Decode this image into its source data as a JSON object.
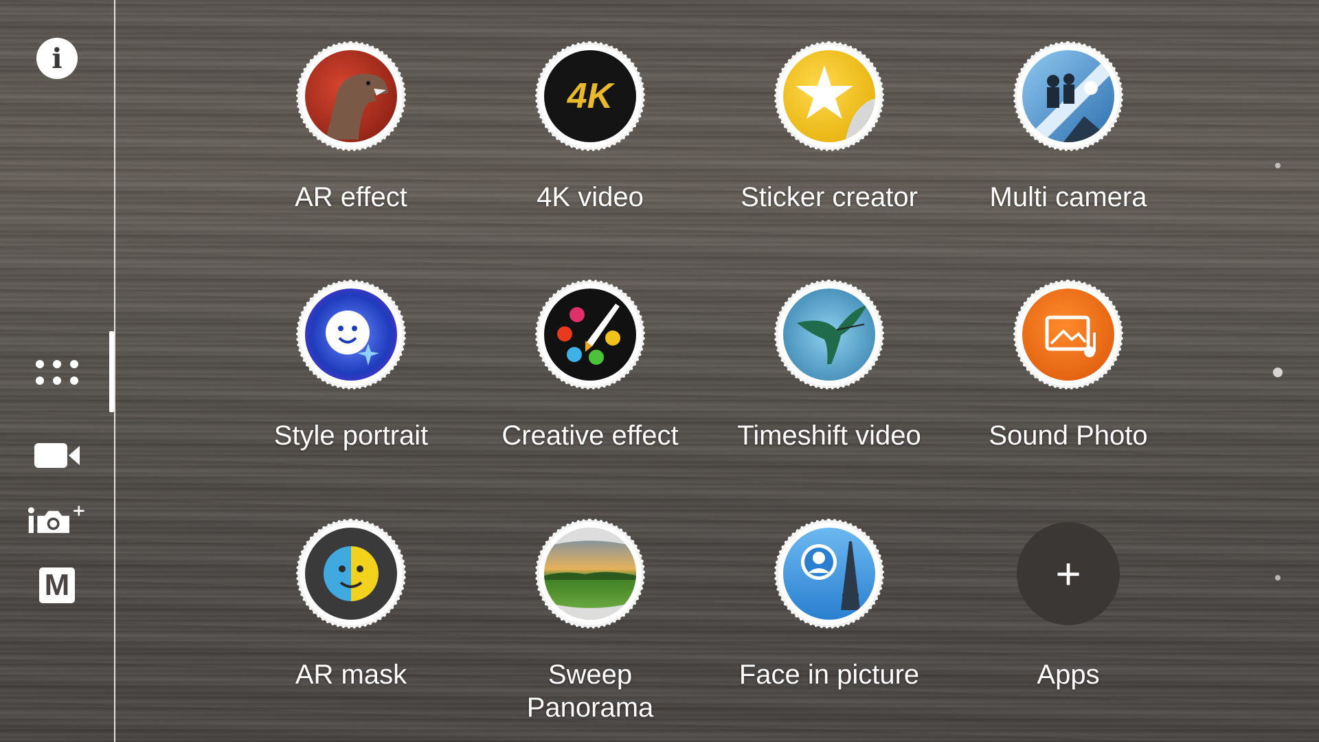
{
  "sidebar": {
    "info_glyph": "i",
    "manual_label": "M",
    "items": [
      {
        "name": "info-icon"
      },
      {
        "name": "apps-grid-icon"
      },
      {
        "name": "video-camera-icon"
      },
      {
        "name": "superior-auto-camera-icon"
      },
      {
        "name": "manual-mode-icon"
      }
    ]
  },
  "apps": [
    {
      "label": "AR effect",
      "icon": "dinosaur-icon",
      "color": "#b32a1e"
    },
    {
      "label": "4K video",
      "icon": "4k-icon",
      "color": "#1a1a1a",
      "badge": "4K"
    },
    {
      "label": "Sticker creator",
      "icon": "sticker-star-icon",
      "color": "#f0c419"
    },
    {
      "label": "Multi camera",
      "icon": "multi-camera-icon",
      "color": "#5aa7e0"
    },
    {
      "label": "Style portrait",
      "icon": "style-portrait-face-icon",
      "color": "#2a56c8"
    },
    {
      "label": "Creative effect",
      "icon": "palette-brush-icon",
      "color": "#111111"
    },
    {
      "label": "Timeshift video",
      "icon": "hummingbird-icon",
      "color": "#3c8bb8"
    },
    {
      "label": "Sound Photo",
      "icon": "sound-photo-icon",
      "color": "#e5660f"
    },
    {
      "label": "AR mask",
      "icon": "ar-mask-face-icon",
      "color": "#3a3a3a"
    },
    {
      "label": "Sweep Panorama",
      "label_line1": "Sweep",
      "label_line2": "Panorama",
      "icon": "panorama-landscape-icon",
      "color": "#4f9a2a"
    },
    {
      "label": "Face in picture",
      "icon": "face-in-picture-icon",
      "color": "#2a7fd0"
    },
    {
      "label": "Apps",
      "icon": "plus-icon",
      "color": "#3a3735",
      "glyph": "+"
    }
  ],
  "pager": {
    "pages": 3
  }
}
